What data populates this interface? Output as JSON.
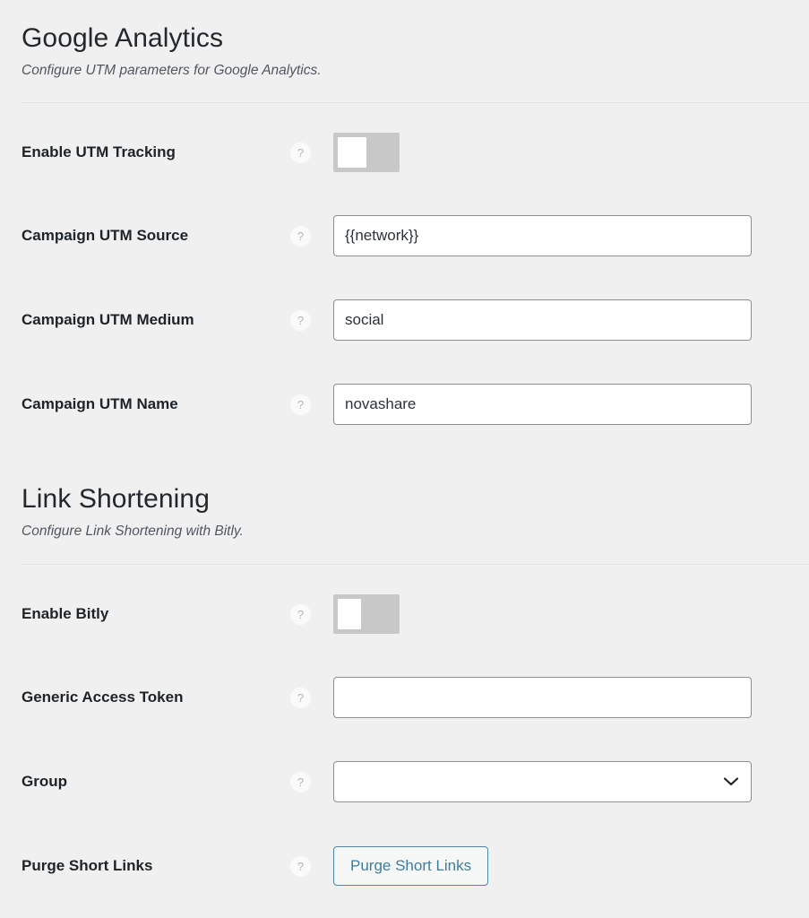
{
  "sections": [
    {
      "id": "google-analytics",
      "title": "Google Analytics",
      "description": "Configure UTM parameters for Google Analytics.",
      "fields": [
        {
          "label": "Enable UTM Tracking",
          "type": "toggle",
          "state": "off",
          "help": "?"
        },
        {
          "label": "Campaign UTM Source",
          "type": "text",
          "value": "{{network}}",
          "placeholder": "",
          "help": "?"
        },
        {
          "label": "Campaign UTM Medium",
          "type": "text",
          "value": "social",
          "placeholder": "",
          "help": "?"
        },
        {
          "label": "Campaign UTM Name",
          "type": "text",
          "value": "novashare",
          "placeholder": "",
          "help": "?"
        }
      ]
    },
    {
      "id": "link-shortening",
      "title": "Link Shortening",
      "description": "Configure Link Shortening with Bitly.",
      "fields": [
        {
          "label": "Enable Bitly",
          "type": "toggle",
          "state": "off",
          "help": "?"
        },
        {
          "label": "Generic Access Token",
          "type": "text",
          "value": "",
          "placeholder": "",
          "help": "?"
        },
        {
          "label": "Group",
          "type": "select",
          "value": "",
          "help": "?"
        },
        {
          "label": "Purge Short Links",
          "type": "button",
          "button_label": "Purge Short Links",
          "help": "?"
        }
      ]
    }
  ],
  "colors": {
    "page_background": "#f0f0f1",
    "label_text": "#1d2327",
    "heading_text": "#23282d",
    "description_text": "#50575e",
    "input_border": "#8c8f94",
    "input_background": "#ffffff",
    "toggle_track_off": "#c8c8c8",
    "toggle_knob": "#ffffff",
    "button_text": "#3e7da0",
    "button_border": "#4a87a8",
    "divider": "#e2e2e4",
    "help_icon_text": "#b4b4b8"
  },
  "icons": {
    "help": "help-circle-icon",
    "dropdown": "chevron-down-icon"
  }
}
